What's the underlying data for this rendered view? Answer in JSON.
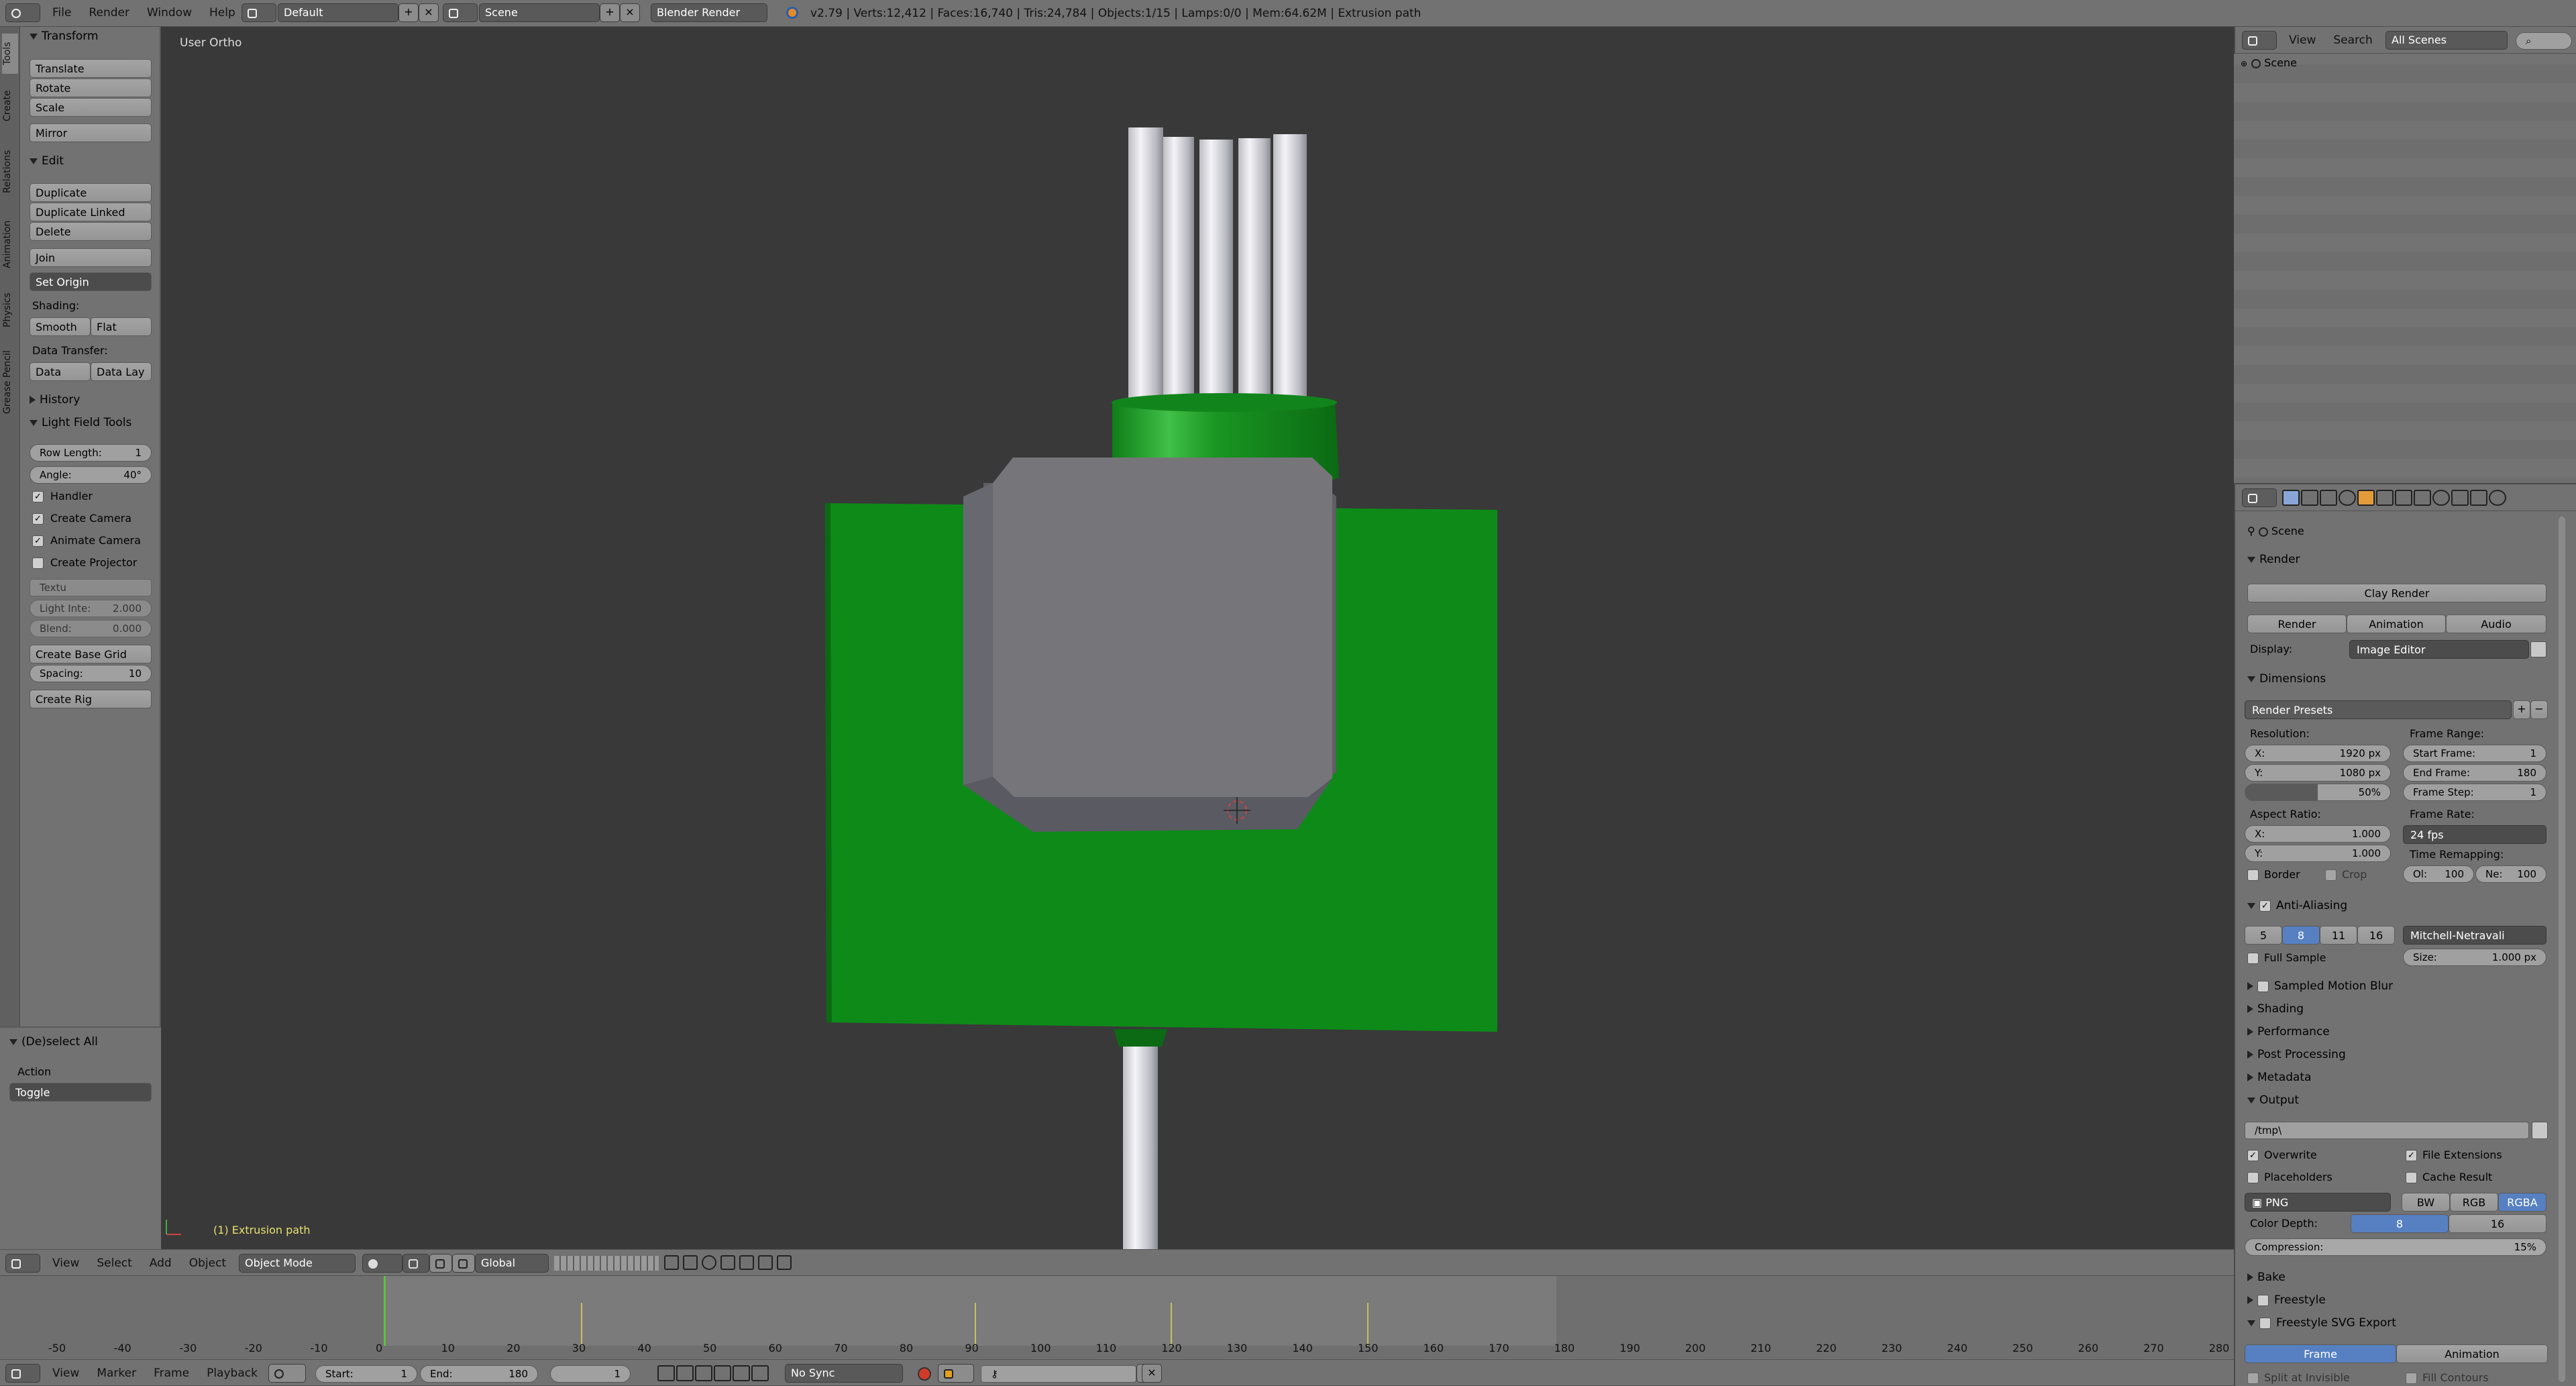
{
  "topbar": {
    "menus": [
      "File",
      "Render",
      "Window",
      "Help"
    ],
    "layout": "Default",
    "scene": "Scene",
    "engine": "Blender Render",
    "stats": "v2.79 | Verts:12,412 | Faces:16,740 | Tris:24,784 | Objects:1/15 | Lamps:0/0 | Mem:64.62M | Extrusion path"
  },
  "tool_tabs": [
    "Tools",
    "Create",
    "Relations",
    "Animation",
    "Physics",
    "Grease Pencil"
  ],
  "toolshelf": {
    "transform": {
      "title": "Transform",
      "buttons": [
        "Translate",
        "Rotate",
        "Scale",
        "Mirror"
      ]
    },
    "edit": {
      "title": "Edit",
      "buttons": [
        "Duplicate",
        "Duplicate Linked",
        "Delete",
        "Join"
      ],
      "set_origin": "Set Origin",
      "shading_label": "Shading:",
      "smooth": "Smooth",
      "flat": "Flat",
      "data_transfer_label": "Data Transfer:",
      "data": "Data",
      "data_lay": "Data Lay"
    },
    "history": "History",
    "lft": {
      "title": "Light Field Tools",
      "row_length_label": "Row Length:",
      "row_length": "1",
      "angle_label": "Angle:",
      "angle": "40°",
      "handler": "Handler",
      "create_camera": "Create Camera",
      "animate_camera": "Animate Camera",
      "create_projector": "Create Projector",
      "textu": "Textu",
      "light_label": "Light Inte:",
      "light": "2.000",
      "blend_label": "Blend:",
      "blend": "0.000",
      "create_base_grid": "Create Base Grid",
      "spacing_label": "Spacing:",
      "spacing": "10",
      "create_rig": "Create Rig"
    },
    "operator": {
      "title": "(De)select All",
      "action_label": "Action",
      "action": "Toggle"
    }
  },
  "viewport": {
    "view_label": "User Ortho",
    "object_label": "(1) Extrusion path"
  },
  "view_header": {
    "menus": [
      "View",
      "Select",
      "Add",
      "Object"
    ],
    "mode": "Object Mode",
    "orientation": "Global"
  },
  "timeline": {
    "ticks": [
      "-50",
      "-40",
      "-30",
      "-20",
      "-10",
      "0",
      "10",
      "20",
      "30",
      "40",
      "50",
      "60",
      "70",
      "80",
      "90",
      "100",
      "110",
      "120",
      "130",
      "140",
      "150",
      "160",
      "170",
      "180",
      "190",
      "200",
      "210",
      "220",
      "230",
      "240",
      "250",
      "260",
      "270",
      "280"
    ],
    "menus": [
      "View",
      "Marker",
      "Frame",
      "Playback"
    ],
    "start_label": "Start:",
    "start": "1",
    "end_label": "End:",
    "end": "180",
    "current": "1",
    "sync": "No Sync"
  },
  "outliner": {
    "menus": [
      "View",
      "Search"
    ],
    "filter": "All Scenes",
    "scene": "Scene"
  },
  "props": {
    "scene": "Scene",
    "render_title": "Render",
    "clay_render": "Clay Render",
    "render": "Render",
    "animation": "Animation",
    "audio": "Audio",
    "display_label": "Display:",
    "display": "Image Editor",
    "dimensions_title": "Dimensions",
    "render_presets": "Render Presets",
    "resolution_label": "Resolution:",
    "res_x_label": "X:",
    "res_x": "1920 px",
    "res_y_label": "Y:",
    "res_y": "1080 px",
    "res_pct": "50%",
    "frame_range_label": "Frame Range:",
    "start_frame_label": "Start Frame:",
    "start_frame": "1",
    "end_frame_label": "End Frame:",
    "end_frame": "180",
    "frame_step_label": "Frame Step:",
    "frame_step": "1",
    "aspect_label": "Aspect Ratio:",
    "asp_x_label": "X:",
    "asp_x": "1.000",
    "asp_y_label": "Y:",
    "asp_y": "1.000",
    "frame_rate_label": "Frame Rate:",
    "frame_rate": "24 fps",
    "time_remap_label": "Time Remapping:",
    "old_label": "Ol:",
    "old": "100",
    "new_label": "Ne:",
    "new": "100",
    "border": "Border",
    "crop": "Crop",
    "aa_title": "Anti-Aliasing",
    "aa_samples": [
      "5",
      "8",
      "11",
      "16"
    ],
    "aa_filter": "Mitchell-Netravali",
    "full_sample": "Full Sample",
    "size_label": "Size:",
    "size": "1.000 px",
    "sections": [
      "Sampled Motion Blur",
      "Shading",
      "Performance",
      "Post Processing",
      "Metadata"
    ],
    "output_title": "Output",
    "output_path": "/tmp\\",
    "overwrite": "Overwrite",
    "file_ext": "File Extensions",
    "placeholders": "Placeholders",
    "cache_result": "Cache Result",
    "format": "PNG",
    "bw": "BW",
    "rgb": "RGB",
    "rgba": "RGBA",
    "color_depth_label": "Color Depth:",
    "depth8": "8",
    "depth16": "16",
    "compression_label": "Compression:",
    "compression": "15%",
    "bake": "Bake",
    "freestyle": "Freestyle",
    "svg_export": "Freestyle SVG Export",
    "frame_tab": "Frame",
    "animation_tab": "Animation",
    "split_invisible": "Split at Invisible",
    "fill_contours": "Fill Contours"
  },
  "colors": {
    "viewport": "#393939",
    "panel": "#727272",
    "selected": "#5680c2",
    "green": "#0d7a17",
    "gray_block": "#76767a"
  }
}
